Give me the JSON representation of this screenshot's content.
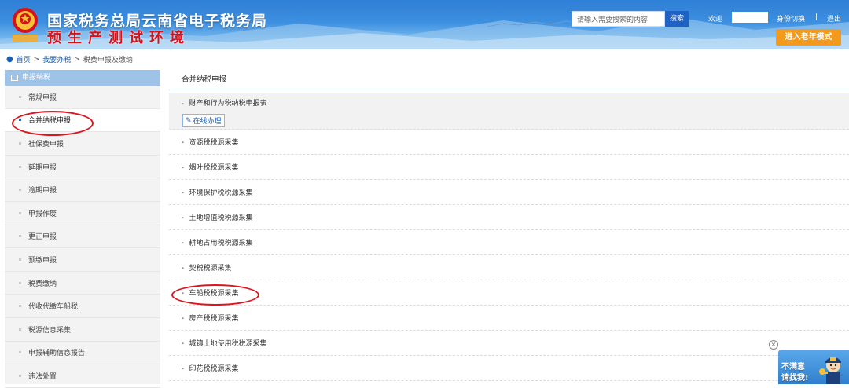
{
  "header": {
    "site_title": "国家税务总局云南省电子税务局",
    "env_title": "预生产测试环境",
    "emblem_text": "中国税务",
    "search_placeholder": "请输入需要搜索的内容",
    "search_button": "搜索",
    "welcome": "欢迎",
    "switch_identity": "身份切换",
    "separator": "|",
    "logout": "退出",
    "elder_mode": "进入老年模式"
  },
  "breadcrumb": {
    "items": [
      "首页",
      "我要办税",
      "税费申报及缴纳"
    ],
    "separator": ">"
  },
  "sidebar": {
    "header": "申报纳税",
    "items": [
      {
        "label": "常规申报"
      },
      {
        "label": "合并纳税申报"
      },
      {
        "label": "社保费申报"
      },
      {
        "label": "延期申报"
      },
      {
        "label": "逾期申报"
      },
      {
        "label": "申报作废"
      },
      {
        "label": "更正申报"
      },
      {
        "label": "预缴申报"
      },
      {
        "label": "税费缴纳"
      },
      {
        "label": "代收代缴车船税"
      },
      {
        "label": "税源信息采集"
      },
      {
        "label": "申报辅助信息报告"
      },
      {
        "label": "违法处置"
      }
    ],
    "active_index": 1
  },
  "main": {
    "title": "合并纳税申报",
    "online_button": "在线办理",
    "items": [
      {
        "label": "财产和行为税纳税申报表"
      },
      {
        "label": "资源税税源采集"
      },
      {
        "label": "烟叶税税源采集"
      },
      {
        "label": "环境保护税税源采集"
      },
      {
        "label": "土地增值税税源采集"
      },
      {
        "label": "耕地占用税税源采集"
      },
      {
        "label": "契税税源采集"
      },
      {
        "label": "车船税税源采集"
      },
      {
        "label": "房产税税源采集"
      },
      {
        "label": "城镇土地使用税税源采集"
      },
      {
        "label": "印花税税源采集"
      }
    ]
  },
  "feedback": {
    "line1": "不满意",
    "line2": "请找我!"
  },
  "colors": {
    "header_blue": "#3d8fe0",
    "brand_red": "#d8101a",
    "accent_orange": "#f39a1d",
    "link_blue": "#1a5fb4",
    "sidebar_header": "#9fc2e7",
    "annotation_red": "#e0141e"
  },
  "icons": [
    "emblem-icon",
    "location-pin-icon",
    "menu-square-icon",
    "edit-icon",
    "close-circle-icon",
    "mascot-icon"
  ]
}
